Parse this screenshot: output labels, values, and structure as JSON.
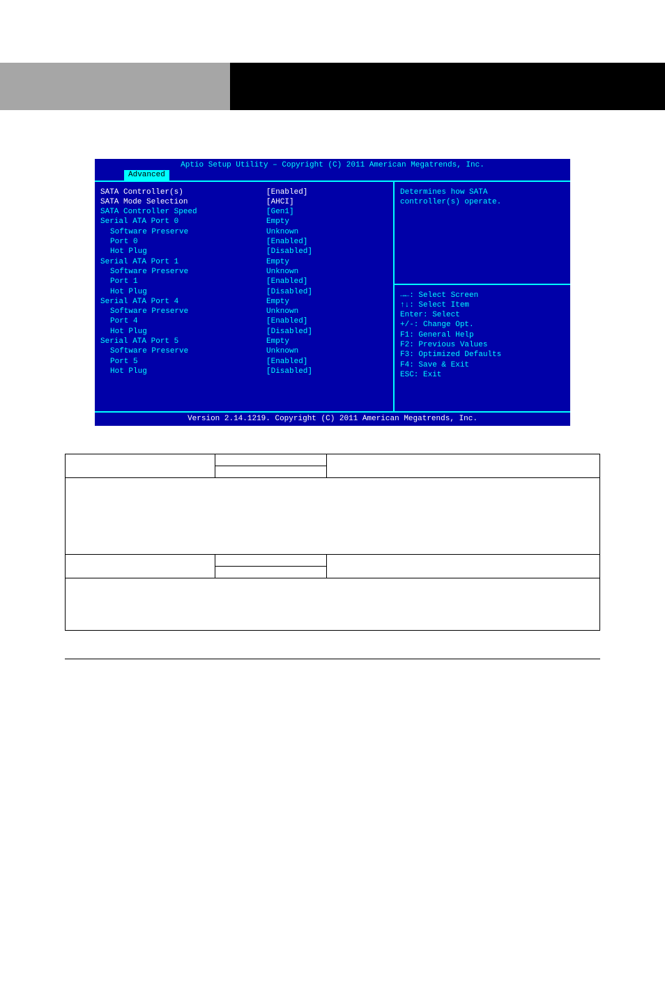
{
  "bios": {
    "title": "Aptio Setup Utility – Copyright (C) 2011 American Megatrends, Inc.",
    "tab": "Advanced",
    "footer": "Version 2.14.1219. Copyright (C) 2011 American Megatrends, Inc.",
    "help_top": [
      "Determines how SATA",
      "controller(s) operate."
    ],
    "help_keys": [
      "→←: Select Screen",
      "↑↓: Select Item",
      "Enter: Select",
      "+/-: Change Opt.",
      "F1: General Help",
      "F2: Previous Values",
      "F3: Optimized Defaults",
      "F4: Save & Exit",
      "ESC: Exit"
    ],
    "rows": [
      {
        "label": "SATA Controller(s)",
        "value": "[Enabled]",
        "style": "sel",
        "indent": false
      },
      {
        "label": "SATA Mode Selection",
        "value": "[AHCI]",
        "style": "sel",
        "indent": false
      },
      {
        "label": "SATA Controller Speed",
        "value": "[Gen1]",
        "style": "blue",
        "indent": false
      },
      {
        "label": "",
        "value": "",
        "style": "",
        "indent": false
      },
      {
        "label": "Serial ATA Port 0",
        "value": "Empty",
        "style": "blue",
        "indent": false
      },
      {
        "label": "Software Preserve",
        "value": "Unknown",
        "style": "blue",
        "indent": true
      },
      {
        "label": "Port 0",
        "value": "[Enabled]",
        "style": "blue",
        "indent": true
      },
      {
        "label": "Hot Plug",
        "value": "[Disabled]",
        "style": "blue",
        "indent": true
      },
      {
        "label": "Serial ATA Port 1",
        "value": "Empty",
        "style": "blue",
        "indent": false
      },
      {
        "label": "Software Preserve",
        "value": "Unknown",
        "style": "blue",
        "indent": true
      },
      {
        "label": "Port 1",
        "value": "[Enabled]",
        "style": "blue",
        "indent": true
      },
      {
        "label": "Hot Plug",
        "value": "[Disabled]",
        "style": "blue",
        "indent": true
      },
      {
        "label": "Serial ATA Port 4",
        "value": "Empty",
        "style": "blue",
        "indent": false
      },
      {
        "label": "Software Preserve",
        "value": "Unknown",
        "style": "blue",
        "indent": true
      },
      {
        "label": "Port 4",
        "value": "[Enabled]",
        "style": "blue",
        "indent": true
      },
      {
        "label": "Hot Plug",
        "value": "[Disabled]",
        "style": "blue",
        "indent": true
      },
      {
        "label": "Serial ATA Port 5",
        "value": "Empty",
        "style": "blue",
        "indent": false
      },
      {
        "label": "Software Preserve",
        "value": "Unknown",
        "style": "blue",
        "indent": true
      },
      {
        "label": "Port 5",
        "value": "[Enabled]",
        "style": "blue",
        "indent": true
      },
      {
        "label": "Hot Plug",
        "value": "[Disabled]",
        "style": "blue",
        "indent": true
      }
    ]
  },
  "table": {
    "row1": {
      "name": "",
      "opt1": "",
      "opt2": "",
      "desc": ""
    },
    "row2_merged": "",
    "row3": {
      "name": "",
      "opt1": "",
      "opt2": "",
      "desc": ""
    },
    "row4_merged": ""
  }
}
